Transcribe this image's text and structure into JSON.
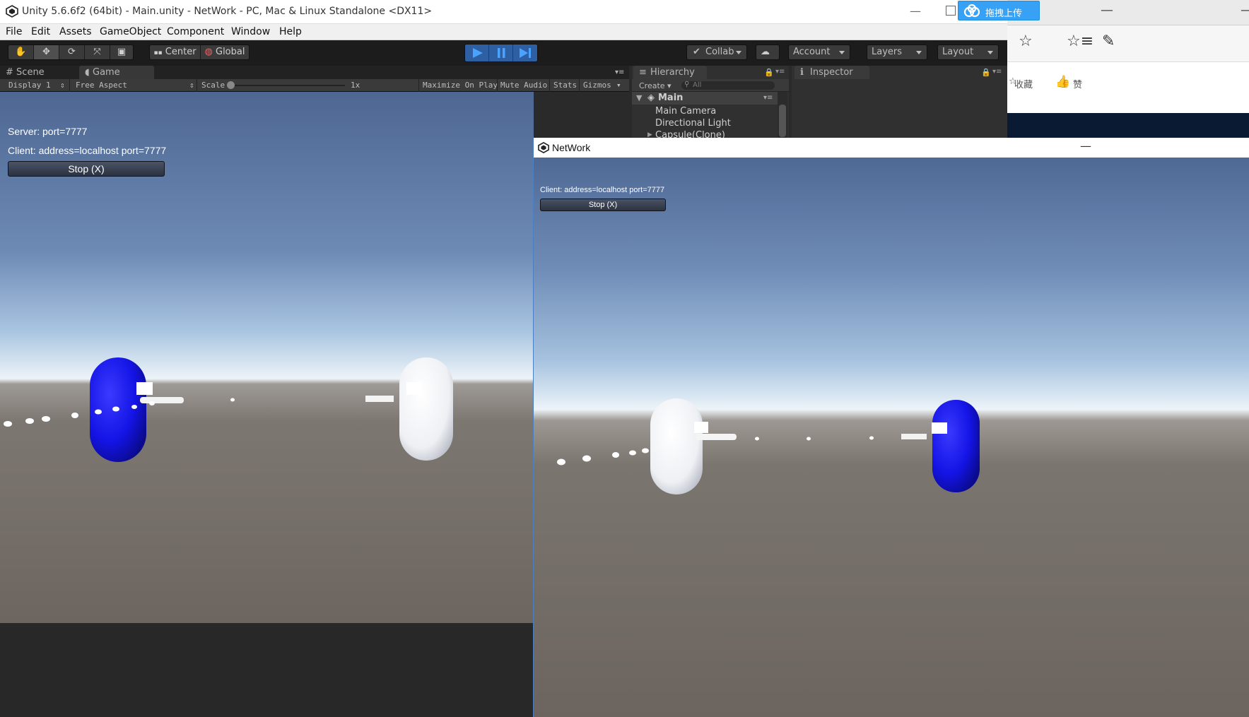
{
  "window": {
    "title": "Unity 5.6.6f2 (64bit) - Main.unity - NetWork - PC, Mac & Linux Standalone <DX11>",
    "upload_label": "拖拽上传"
  },
  "browser": {
    "collect_label": "收藏",
    "like_label": "赞"
  },
  "menu": [
    "File",
    "Edit",
    "Assets",
    "GameObject",
    "Component",
    "Window",
    "Help"
  ],
  "toolbar": {
    "pivot_label": "Center",
    "space_label": "Global",
    "collab_label": "Collab",
    "account_label": "Account",
    "layers_label": "Layers",
    "layout_label": "Layout"
  },
  "tabs": {
    "scene": "Scene",
    "game": "Game",
    "hierarchy": "Hierarchy",
    "inspector": "Inspector"
  },
  "gamebar": {
    "display": "Display 1",
    "aspect": "Free Aspect",
    "scale_label": "Scale",
    "scale_value": "1x",
    "maximize": "Maximize On Play",
    "mute": "Mute Audio",
    "stats": "Stats",
    "gizmos": "Gizmos"
  },
  "hierarchy": {
    "create_label": "Create",
    "search_placeholder": "All",
    "scene_name": "Main",
    "items": [
      "Main Camera",
      "Directional Light",
      "Capsule(Clone)"
    ]
  },
  "game_left": {
    "server_text": "Server: port=7777",
    "client_text": "Client: address=localhost port=7777",
    "stop_label": "Stop (X)"
  },
  "network_window": {
    "title": "NetWork",
    "client_text": "Client: address=localhost port=7777",
    "stop_label": "Stop (X)"
  },
  "colors": {
    "player_blue": "#1414e6",
    "player_white": "#f2f4f7",
    "play_accent": "#2d5fa2",
    "upload_accent": "#37a2f5"
  }
}
